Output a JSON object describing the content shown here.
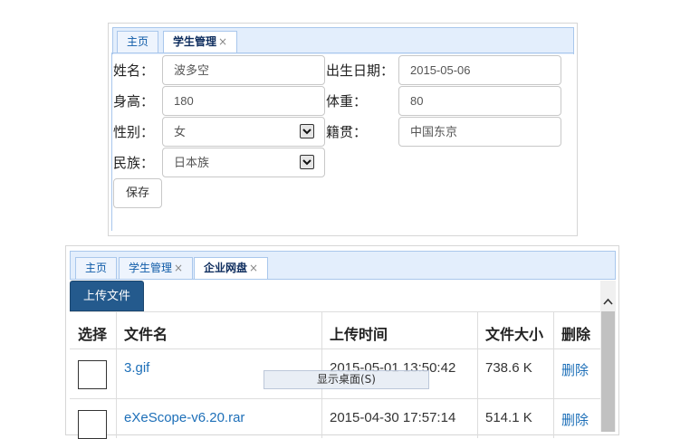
{
  "student_form": {
    "tabs": [
      {
        "label": "主页"
      },
      {
        "label": "学生管理",
        "close": "×"
      }
    ],
    "fields": {
      "name_label": "姓名：",
      "name_value": "波多空",
      "birth_label": "出生日期：",
      "birth_value": "2015-05-06",
      "height_label": "身高：",
      "height_value": "180",
      "weight_label": "体重：",
      "weight_value": "80",
      "gender_label": "性别：",
      "gender_value": "女",
      "origin_label": "籍贯：",
      "origin_value": "中国东京",
      "ethnicity_label": "民族：",
      "ethnicity_value": "日本族"
    },
    "save_label": "保存"
  },
  "netdisk": {
    "tabs": [
      {
        "label": "主页"
      },
      {
        "label": "学生管理",
        "close": "×"
      },
      {
        "label": "企业网盘",
        "close": "×"
      }
    ],
    "upload_label": "上传文件",
    "columns": [
      "选择",
      "文件名",
      "上传时间",
      "文件大小",
      "删除"
    ],
    "rows": [
      {
        "name": "3.gif",
        "time": "2015-05-01 13:50:42",
        "size": "738.6 K",
        "action": "删除"
      },
      {
        "name": "eXeScope-v6.20.rar",
        "time": "2015-04-30 17:57:14",
        "size": "514.1 K",
        "action": "删除"
      }
    ],
    "tooltip": "显示桌面(S)"
  }
}
